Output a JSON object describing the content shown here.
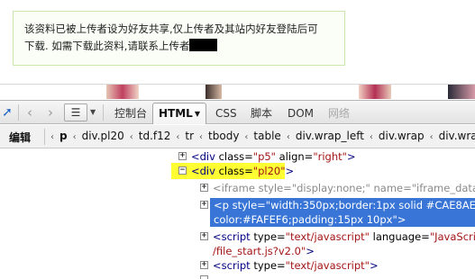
{
  "notice": {
    "line1": "该资料已被上传者设为好友共享,仅上传者及其站内好友登陆后可",
    "line2": "下载. 如需下载此资料,请联系上传者"
  },
  "toolbar": {
    "inspect_icon": "inspect-arrow-icon",
    "back_icon": "chevron-left-icon",
    "forward_icon": "chevron-right-icon",
    "menu_icon": "hamburger-menu-icon",
    "tabs": [
      "控制台",
      "HTML",
      "CSS",
      "脚本",
      "DOM",
      "网络"
    ],
    "active_tab": "HTML"
  },
  "breadcrumb": {
    "edit_label": "编辑",
    "items": [
      "p",
      "div.pl20",
      "td.f12",
      "tr",
      "tbody",
      "table",
      "div.wrap_left",
      "div.wrap",
      "div.wra"
    ]
  },
  "tree": {
    "row1": {
      "toggle": "+",
      "tag_open": "<div",
      "attr1": " class=",
      "val1": "\"p5\"",
      "attr2": " align=",
      "val2": "\"right\"",
      "tag_close": ">"
    },
    "row2": {
      "toggle": "−",
      "tag_open": "<div",
      "attr1": " class=",
      "val1": "\"pl20\"",
      "tag_close": ">"
    },
    "row3": {
      "toggle": "+",
      "tag_open": "<iframe",
      "attr1": " style=",
      "val1": "\"display:none;\"",
      "attr2": " name=",
      "val2": "\"iframe_data\"",
      "tag_close": ">"
    },
    "row4": {
      "toggle": "+",
      "line1": "<p style=\"width:350px;border:1px solid #CAE8AE;backg",
      "line2": "color:#FAFEF6;padding:15px 10px\">"
    },
    "row5": {
      "toggle": "+",
      "tag_open": "<script",
      "attr1": " type=",
      "val1": "\"text/javascript\"",
      "attr2": " language=",
      "val2": "\"JavaScript\"",
      "attr3": " sr",
      "cont": "/file_start.js?v2.0\"",
      "tag_close": ">"
    },
    "row6": {
      "toggle": "+",
      "tag_open": "<script",
      "attr1": " type=",
      "val1": "\"text/javascript\"",
      "tag_close": ">"
    }
  }
}
